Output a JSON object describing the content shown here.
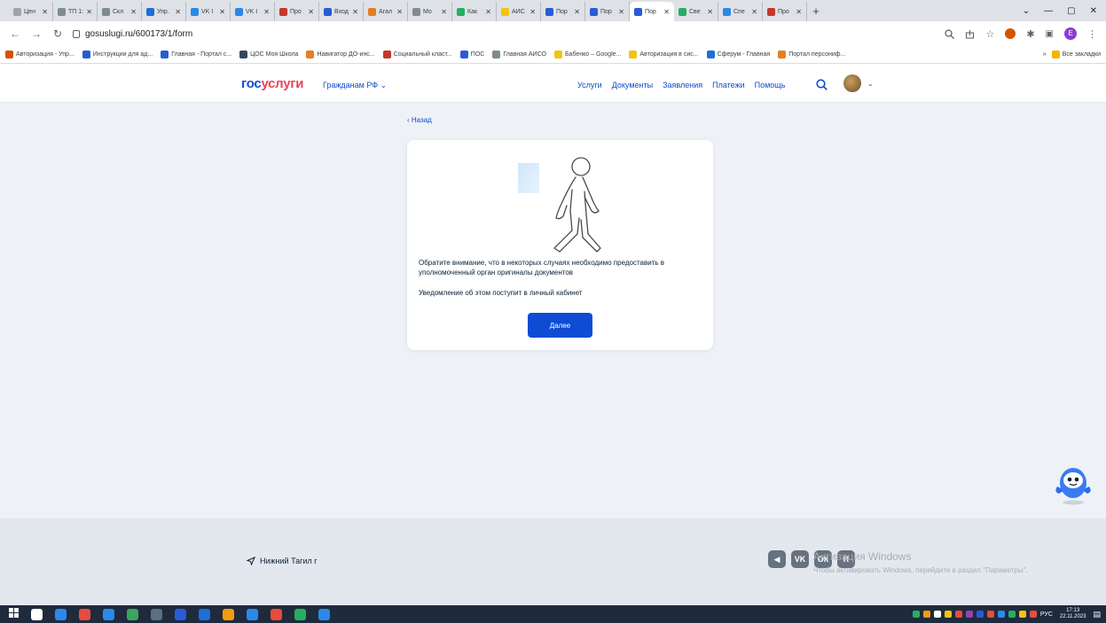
{
  "browser": {
    "tabs": [
      {
        "title": "Цен",
        "color": "#a0a4a8"
      },
      {
        "title": "ТП 1:",
        "color": "#7f8c8d"
      },
      {
        "title": "Скл",
        "color": "#7f8c8d"
      },
      {
        "title": "Упр.",
        "color": "#1f6fd6"
      },
      {
        "title": "VK I",
        "color": "#2a89e8"
      },
      {
        "title": "VK I",
        "color": "#2a89e8"
      },
      {
        "title": "Про",
        "color": "#c0392b"
      },
      {
        "title": "Вход",
        "color": "#2a5bd7"
      },
      {
        "title": "Агал",
        "color": "#e67e22"
      },
      {
        "title": "Мо",
        "color": "#7f8c8d"
      },
      {
        "title": "Как",
        "color": "#27ae60"
      },
      {
        "title": "АИС",
        "color": "#f1c40f"
      },
      {
        "title": "Пор",
        "color": "#2a5bd7"
      },
      {
        "title": "Пор",
        "color": "#2a5bd7"
      },
      {
        "title": "Пор",
        "color": "#2a5bd7",
        "active": true
      },
      {
        "title": "Све",
        "color": "#27ae60"
      },
      {
        "title": "Спе",
        "color": "#2a89e8"
      },
      {
        "title": "Про",
        "color": "#c0392b"
      }
    ],
    "new_tab": "+",
    "window_controls": [
      "⌄",
      "—",
      "▢",
      "✕"
    ],
    "url": "gosuslugi.ru/600173/1/form"
  },
  "bookmarks": {
    "items": [
      {
        "label": "Авторизация - Упр...",
        "color": "#d35400"
      },
      {
        "label": "Инструкции для ад...",
        "color": "#2a5bd7"
      },
      {
        "label": "Главная - Портал с...",
        "color": "#2a5bd7"
      },
      {
        "label": "ЦОС Моя Школа",
        "color": "#34495e"
      },
      {
        "label": "Навигатор ДО-инс...",
        "color": "#e67e22"
      },
      {
        "label": "Социальный класт...",
        "color": "#c0392b"
      },
      {
        "label": "ПОС",
        "color": "#2a5bd7"
      },
      {
        "label": "Главная АИСО",
        "color": "#7f8c8d"
      },
      {
        "label": "Бабенко – Google...",
        "color": "#f1c40f"
      },
      {
        "label": "Авторизация в сис...",
        "color": "#f1c40f"
      },
      {
        "label": "Сферум - Главная",
        "color": "#1f6fd6"
      },
      {
        "label": "Портал персониф...",
        "color": "#e67e22"
      }
    ],
    "more": "»",
    "all_bookmarks": "Все закладки"
  },
  "header": {
    "logo_part1": "гос",
    "logo_part2": "услуги",
    "citizens": "Гражданам РФ ⌄",
    "nav": [
      "Услуги",
      "Документы",
      "Заявления",
      "Платежи",
      "Помощь"
    ],
    "chevron": "⌄"
  },
  "main": {
    "back": "‹ Назад",
    "line1": "Обратите внимание, что в некоторых случаях необходимо предоставить в уполномоченный орган оригиналы документов",
    "line2": "Уведомление об этом поступит в личный кабинет",
    "button": "Далее"
  },
  "footer": {
    "city": "Нижний Тагил г",
    "social": [
      "◀",
      "VK",
      "ОК",
      "R"
    ],
    "watermark_title": "Активация Windows",
    "watermark_text": "Чтобы активировать Windows, перейдите в раздел \"Параметры\"."
  },
  "taskbar": {
    "icons": [
      "#ffffff",
      "#ffffff",
      "#ffffff",
      "#2a89e8",
      "#e74c3c",
      "#2a89e8",
      "#3aa55c",
      "#5b6f85",
      "#2a5bd7",
      "#1f6fd6",
      "#f39c12",
      "#2a89e8",
      "#e74c3c",
      "#27ae60",
      "#2a89e8"
    ],
    "tray_icons": [
      "#e74c3c",
      "#f1c40f",
      "#27ae60",
      "#2a89e8",
      "#e74c3c",
      "#2a5bd7",
      "#8e44ad",
      "#e74c3c",
      "#f1c40f",
      "#ffffff",
      "#f39c12",
      "#27ae60"
    ],
    "lang": "РУС",
    "time": "17:13",
    "date": "22.11.2023"
  }
}
